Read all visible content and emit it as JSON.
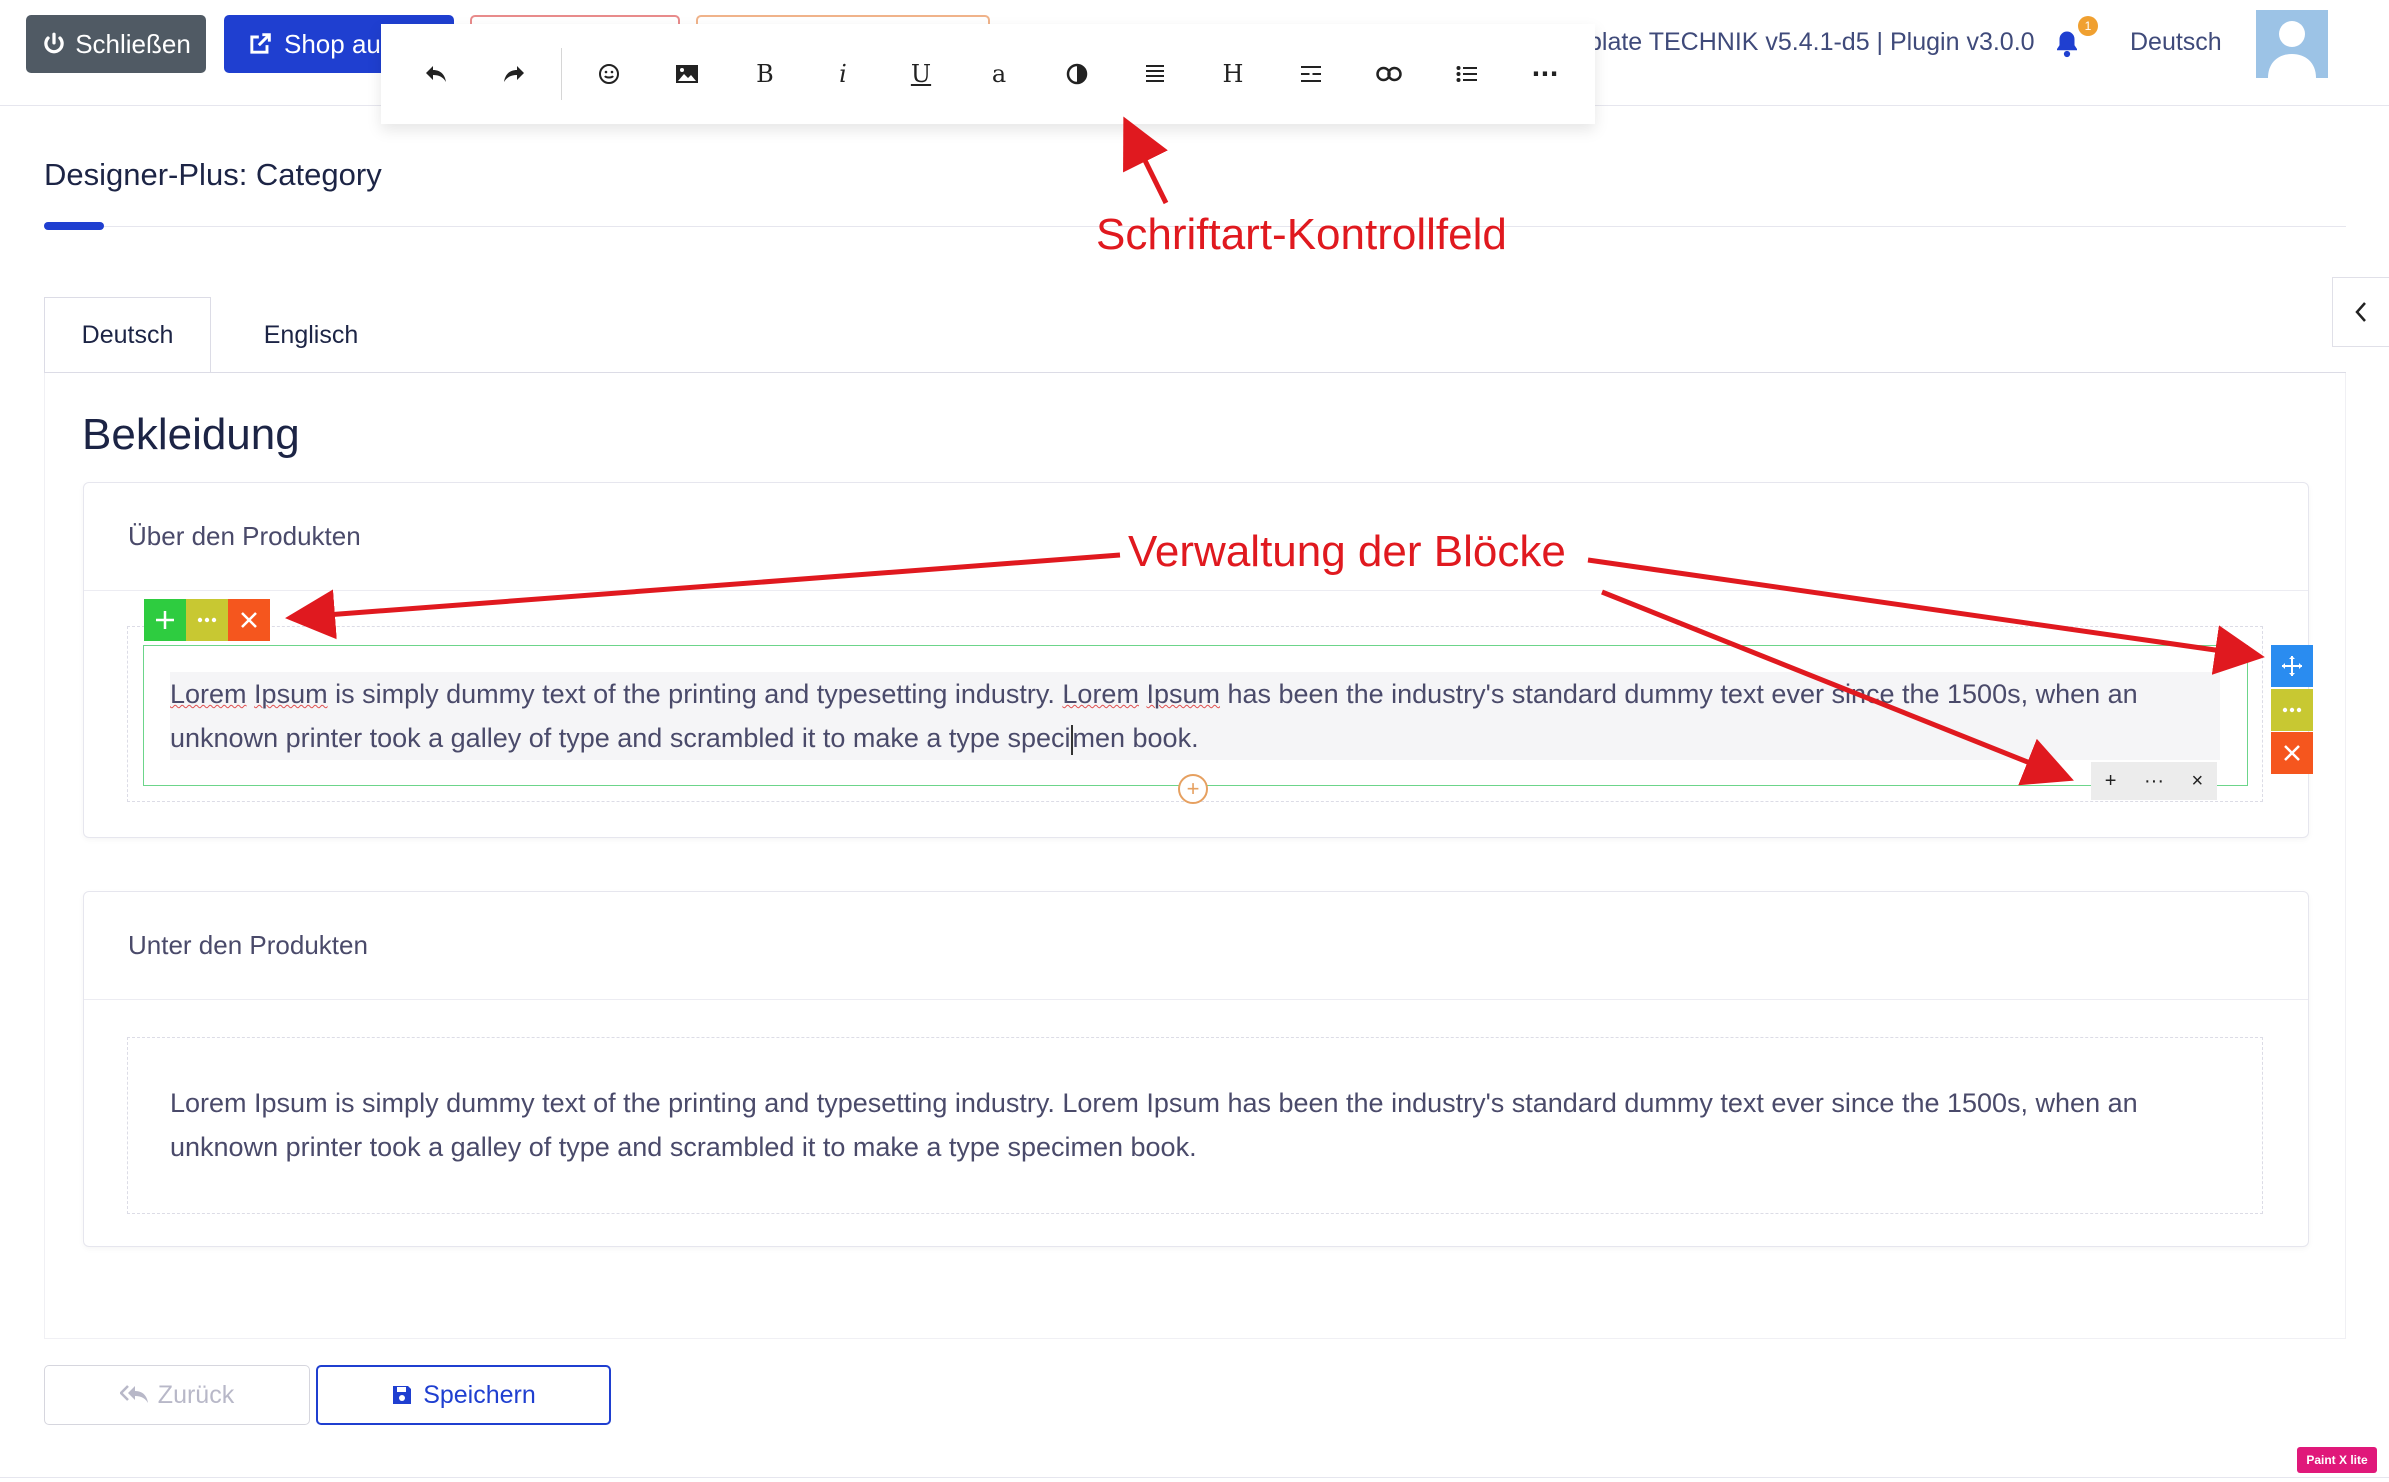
{
  "header": {
    "close_label": "Schließen",
    "shop_label": "Shop aufr",
    "version": "plate TECHNIK v5.4.1-d5 | Plugin v3.0.0",
    "notification_count": "1",
    "language": "Deutsch"
  },
  "toolbar": {
    "items": [
      "undo-icon",
      "redo-icon",
      "emoji-icon",
      "image-icon",
      "bold",
      "italic",
      "underline",
      "font-color",
      "contrast-icon",
      "align-icon",
      "heading",
      "line-height-icon",
      "link-icon",
      "list-icon",
      "more-icon"
    ],
    "bold_label": "B",
    "italic_label": "i",
    "underline_label": "U",
    "font_label": "a",
    "heading_label": "H",
    "more_label": "···"
  },
  "page": {
    "title": "Designer-Plus: Category",
    "tabs": [
      {
        "label": "Deutsch",
        "active": true
      },
      {
        "label": "Englisch",
        "active": false
      }
    ],
    "heading": "Bekleidung"
  },
  "sections": [
    {
      "title": "Über den Produkten",
      "text_parts": [
        "Lorem",
        " ",
        "Ipsum",
        " is simply dummy text of the printing and typesetting industry. ",
        "Lorem",
        " ",
        "Ipsum",
        " has been the industry's standard dummy text ever since the 1500s, when an unknown printer took a galley of type and scrambled it to make a type speci",
        "men book."
      ]
    },
    {
      "title": "Unter den Produkten",
      "text": "Lorem Ipsum is simply dummy text of the printing and typesetting industry. Lorem Ipsum has been the industry's standard dummy text ever since the 1500s, when an unknown printer took a galley of type and scrambled it to make a type specimen book."
    }
  ],
  "block_controls": {
    "add": "+",
    "more": "···",
    "remove": "×"
  },
  "annotations": {
    "font_control": "Schriftart-Kontrollfeld",
    "block_management": "Verwaltung der Blöcke"
  },
  "footer": {
    "back_label": "Zurück",
    "save_label": "Speichern"
  },
  "badge": "Paint X lite",
  "colors": {
    "primary": "#1f3fd0",
    "close_button": "#505a64",
    "add_green": "#2ecc40",
    "more_yellow": "#c8c832",
    "remove_orange": "#f5561e",
    "move_blue": "#2a8cf0",
    "annotation_red": "#e0191f",
    "block_border": "#6cd58a"
  }
}
